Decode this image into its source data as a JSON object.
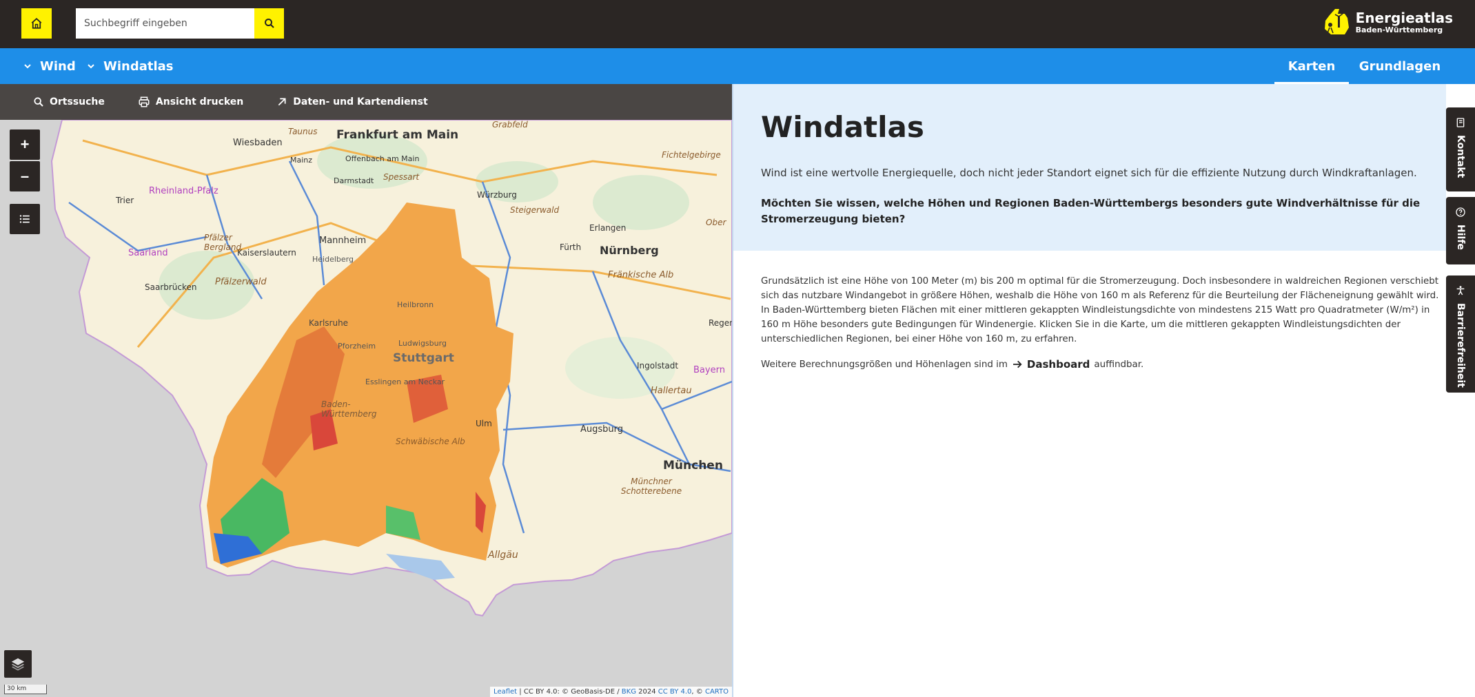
{
  "header": {
    "search_placeholder": "Suchbegriff eingeben",
    "logo_title": "Energieatlas",
    "logo_subtitle": "Baden-Württemberg",
    "accent_color": "#fff200"
  },
  "nav": {
    "breadcrumbs": [
      {
        "label": "Wind"
      },
      {
        "label": "Windatlas"
      }
    ],
    "tabs": [
      {
        "label": "Karten",
        "active": true
      },
      {
        "label": "Grundlagen",
        "active": false
      }
    ]
  },
  "map_toolbar": {
    "items": [
      {
        "label": "Ortssuche",
        "icon": "search-icon"
      },
      {
        "label": "Ansicht drucken",
        "icon": "printer-icon"
      },
      {
        "label": "Daten- und Kartendienst",
        "icon": "arrow-up-right-icon"
      }
    ]
  },
  "map": {
    "zoom_in": "+",
    "zoom_out": "–",
    "scale": "30 km",
    "attribution": {
      "leaflet": "Leaflet",
      "part1": " | CC BY 4.0: © GeoBasis-DE / ",
      "bkg": "BKG",
      "part2": " 2024 ",
      "ccby": "CC BY 4.0",
      "part3": ", © ",
      "carto": "CARTO"
    },
    "labels": [
      "Frankfurt am Main",
      "Wiesbaden",
      "Mainz",
      "Offenbach am Main",
      "Darmstadt",
      "Spessart",
      "Würzburg",
      "Steigerwald",
      "Fichtelgebirge",
      "Erlangen",
      "Fürth",
      "Nürnberg",
      "Fränkische Alb",
      "Trier",
      "Rheinland-Pfalz",
      "Saarland",
      "Kaiserslautern",
      "Pfälzer Bergland",
      "Pfälzerwald",
      "Saarbrücken",
      "Mannheim",
      "Heidelberg",
      "Heilbronn",
      "Karlsruhe",
      "Pforzheim",
      "Ludwigsburg",
      "Stuttgart",
      "Esslingen am Neckar",
      "Baden-Württemberg",
      "Schwäbische Alb",
      "Ulm",
      "Augsburg",
      "Ingolstadt",
      "Bayern",
      "Hallertau",
      "München",
      "Münchner Schotterebene",
      "Allgäu",
      "Regen",
      "Ober",
      "Grabfeld",
      "Taunus"
    ]
  },
  "intro": {
    "title": "Windatlas",
    "lead": "Wind ist eine wertvolle Energiequelle, doch nicht jeder Standort eignet sich für die effiziente Nutzung durch Windkraftanlagen.",
    "question": "Möchten Sie wissen, welche Höhen und Regionen Baden-Württembergs besonders gute Windverhältnisse für die Stromerzeugung bieten?"
  },
  "content": {
    "body": "Grundsätzlich ist eine Höhe von 100 Meter (m) bis 200 m optimal für die Stromerzeugung. Doch insbesondere in waldreichen Regionen verschiebt sich das nutzbare Windangebot in größere Höhen, weshalb die Höhe von 160 m als Referenz für die Beurteilung der Flächeneignung gewählt wird. In Baden-Württemberg bieten Flächen mit einer mittleren gekappten Windleistungsdichte von mindestens 215 Watt pro Quadratmeter (W/m²) in 160 m Höhe besonders gute Bedingungen für Windenergie. Klicken Sie in die Karte, um die mittleren gekappten Windleistungsdichten der unterschiedlichen Regionen, bei einer Höhe von 160 m, zu erfahren.",
    "more_prefix": "Weitere Berechnungsgrößen und Höhenlagen sind im",
    "more_link": "Dashboard",
    "more_suffix": "auffindbar."
  },
  "side_tabs": [
    {
      "label": "Kontakt",
      "icon": "contact-book-icon"
    },
    {
      "label": "Hilfe",
      "icon": "help-icon"
    },
    {
      "label": "Barrierefreiheit",
      "icon": "accessibility-icon"
    }
  ]
}
